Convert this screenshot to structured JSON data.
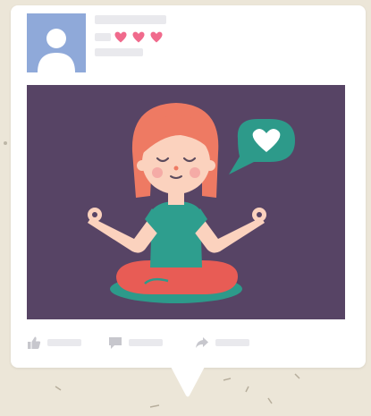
{
  "post": {
    "reactions": {
      "icon": "heart-icon",
      "count": 3,
      "color": "#f06a8c"
    },
    "actions": [
      {
        "name": "like",
        "icon": "thumbs-up-icon"
      },
      {
        "name": "comment",
        "icon": "comment-icon"
      },
      {
        "name": "share",
        "icon": "share-arrow-icon"
      }
    ]
  },
  "colors": {
    "background": "#ece6d8",
    "card": "#ffffff",
    "placeholder_bar": "#e9e9ed",
    "avatar": "#8fa9d9",
    "photo_background": "#574465",
    "hair": "#ee7a63",
    "skin": "#fbd2be",
    "shirt": "#2e9e8e",
    "pants": "#e85c55",
    "mat": "#2d9a8a",
    "bubble": "#2d9a8a",
    "icons": "#c7c7cd"
  }
}
